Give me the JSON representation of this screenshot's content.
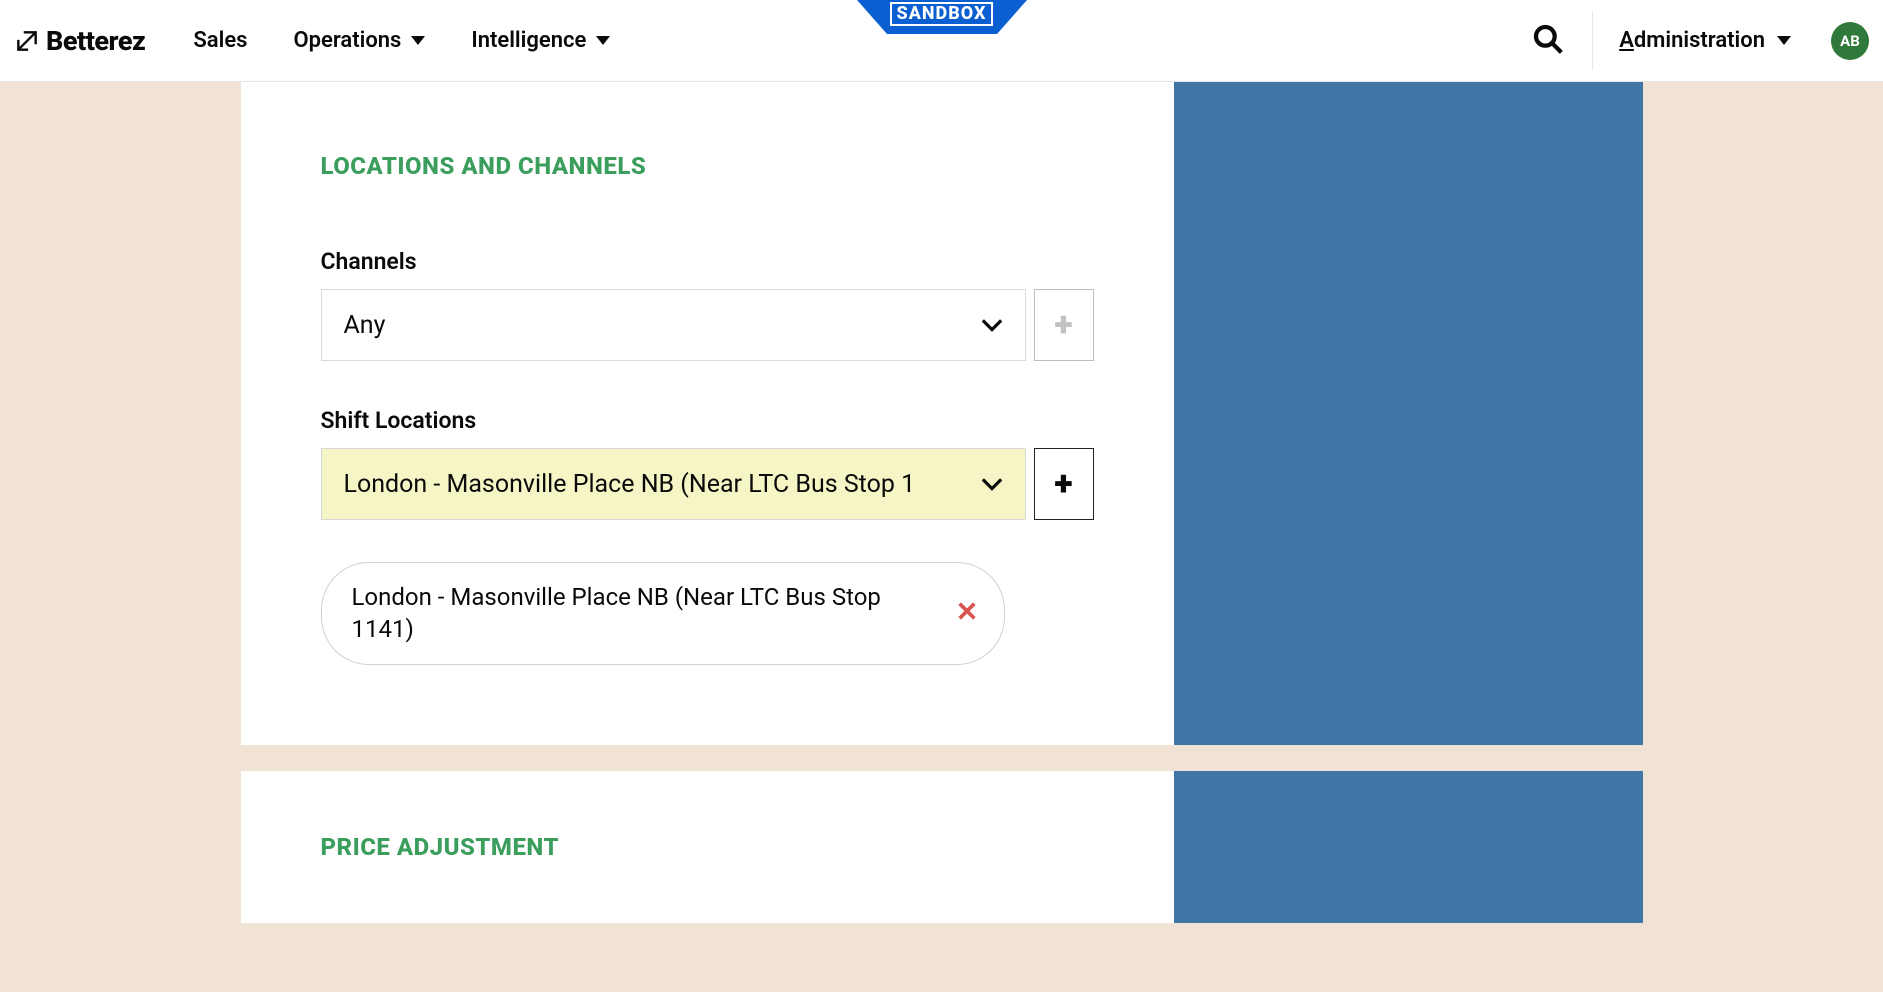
{
  "header": {
    "brand": "Betterez",
    "nav": {
      "sales": "Sales",
      "operations": "Operations",
      "intelligence": "Intelligence"
    },
    "sandbox": "SANDBOX",
    "admin": "dministration",
    "admin_first_letter": "A",
    "avatar": "AB"
  },
  "section1": {
    "title": "LOCATIONS AND CHANNELS",
    "channels_label": "Channels",
    "channels_value": "Any",
    "shift_label": "Shift Locations",
    "shift_value": "London - Masonville Place NB (Near LTC Bus Stop 1",
    "chip_text": "London - Masonville Place NB (Near LTC Bus Stop 1141)"
  },
  "section2": {
    "title": "PRICE ADJUSTMENT"
  }
}
